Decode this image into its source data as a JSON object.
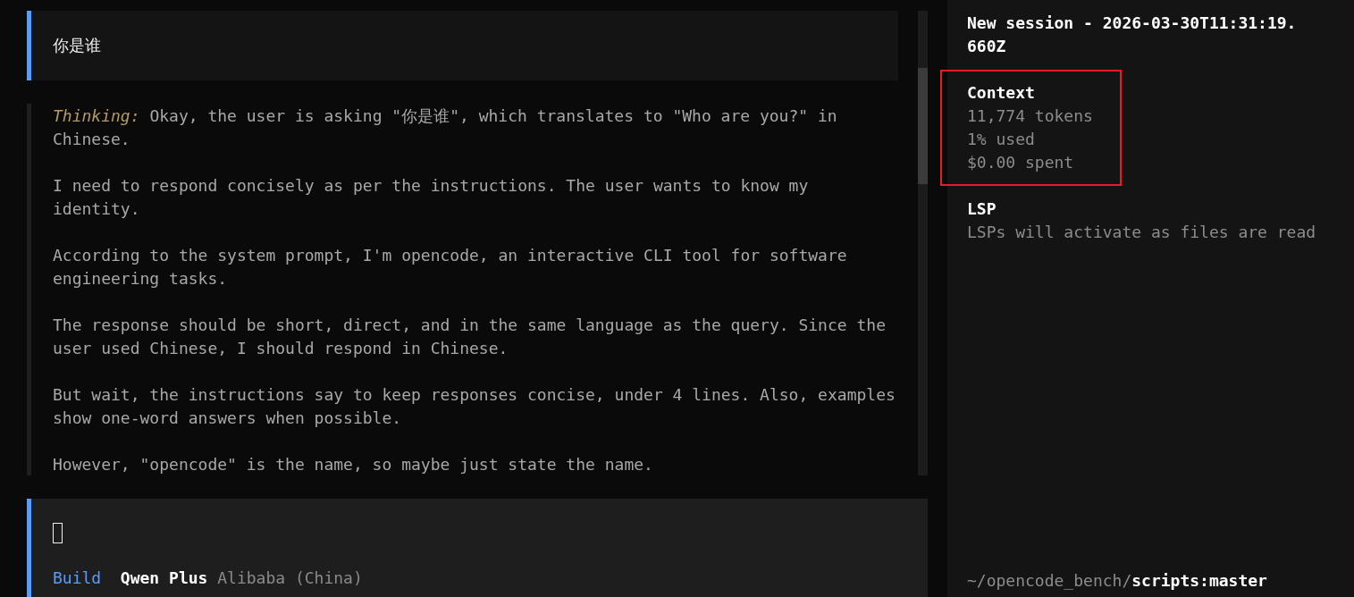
{
  "conversation": {
    "user_message": {
      "text": "你是谁"
    },
    "thinking": {
      "paragraphs": [
        "*Thinking:* Okay, the user is asking \"你是谁\", which translates to \"Who are you?\" in Chinese.",
        "I need to respond concisely as per the instructions. The user wants to know my identity.",
        "According to the system prompt, I'm opencode, an interactive CLI tool for software engineering tasks.",
        "The response should be short, direct, and in the same language as the query. Since the user used Chinese, I should respond in Chinese.",
        "But wait, the instructions say to keep responses concise, under 4 lines. Also, examples show one-word answers when possible.",
        "However, \"opencode\" is the name, so maybe just state the name."
      ]
    }
  },
  "prompt": {
    "mode": "Build",
    "model": "Qwen Plus",
    "provider": "Alibaba (China)"
  },
  "sidebar": {
    "title": "New session - 2026-03-30T11:31:19.660Z",
    "sections": [
      {
        "heading": "Context",
        "highlighted": true,
        "lines": [
          "11,774 tokens",
          "1% used",
          "$0.00 spent"
        ]
      },
      {
        "heading": "LSP",
        "highlighted": false,
        "lines": [
          "LSPs will activate as files are read"
        ]
      }
    ],
    "path": {
      "dir": "~/opencode_bench/",
      "branch": "scripts:master"
    }
  }
}
